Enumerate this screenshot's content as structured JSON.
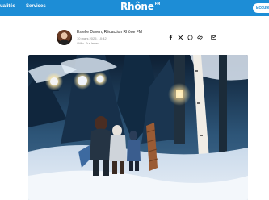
{
  "header": {
    "nav": [
      {
        "label": "ualités"
      },
      {
        "label": "Services"
      }
    ],
    "logo": "Rhône",
    "logo_mark": "FM",
    "listen_label": "Ecouter"
  },
  "article": {
    "author": "Estelle Daven, Rédaction Rhône FM",
    "date": "10 mars 2025, 10:42",
    "read_time": "/ Min. Fur lesen"
  },
  "share_icons": [
    "facebook-icon",
    "x-icon",
    "whatsapp-icon",
    "link-icon",
    "mail-icon"
  ],
  "colors": {
    "brand": "#1d8dd6",
    "text": "#222222",
    "muted": "#8a8a8a"
  }
}
